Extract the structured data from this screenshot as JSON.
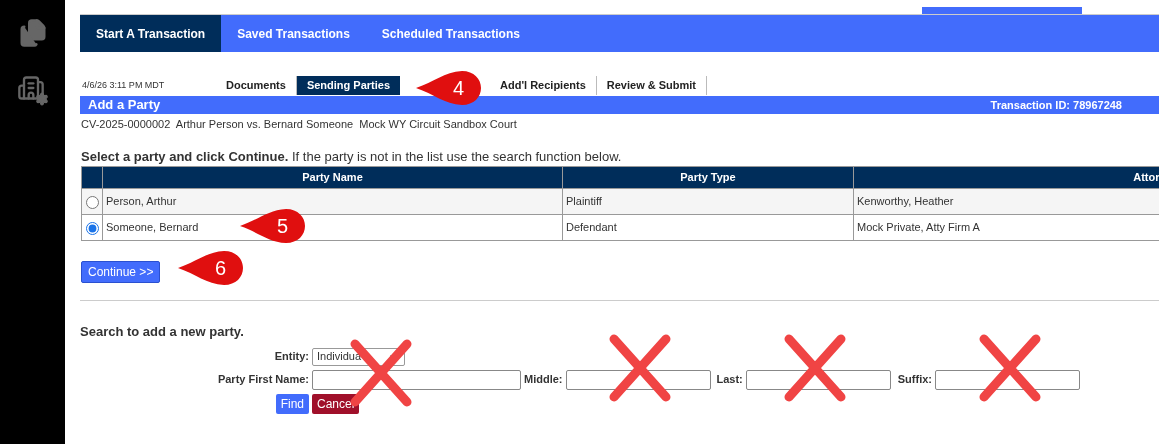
{
  "top_nav": {
    "tabs": [
      {
        "label": "Start A Transaction",
        "selected": true
      },
      {
        "label": "Saved Transactions",
        "selected": false
      },
      {
        "label": "Scheduled Transactions",
        "selected": false
      }
    ]
  },
  "step_bar": {
    "timestamp": "4/6/26 3:11 PM MDT",
    "tabs": [
      {
        "label": "Documents",
        "selected": false
      },
      {
        "label": "Sending Parties",
        "selected": true
      },
      {
        "label": "Add'l Recipients",
        "selected": false
      },
      {
        "label": "Review & Submit",
        "selected": false
      }
    ]
  },
  "section": {
    "title": "Add a Party",
    "transaction_id": "Transaction ID: 78967248",
    "case_line": "CV-2025-0000002  Arthur Person vs. Bernard Someone  Mock WY Circuit Sandbox Court"
  },
  "instruction": "**Select a party and click Continue.** If the party is not in the list use the search function below.",
  "table": {
    "columns": [
      "Party Name",
      "Party Type",
      "Attor"
    ],
    "rows": [
      {
        "selected": false,
        "cells": [
          "Person, Arthur",
          "Plaintiff",
          "Kenworthy, Heather"
        ]
      },
      {
        "selected": true,
        "cells": [
          "Someone, Bernard",
          "Defendant",
          "Mock Private, Atty Firm A"
        ]
      }
    ]
  },
  "continue_button": "Continue >>",
  "search": {
    "title": "Search to add a new party.",
    "entity_label": "Entity:",
    "entity_value": "Individua",
    "first_label": "Party First Name:",
    "middle_label": "Middle:",
    "last_label": "Last:",
    "suffix_label": "Suffix:",
    "find_button": "Find",
    "cancel_button": "Cancel"
  },
  "callouts": [
    {
      "number": "4"
    },
    {
      "number": "5"
    },
    {
      "number": "6"
    }
  ]
}
